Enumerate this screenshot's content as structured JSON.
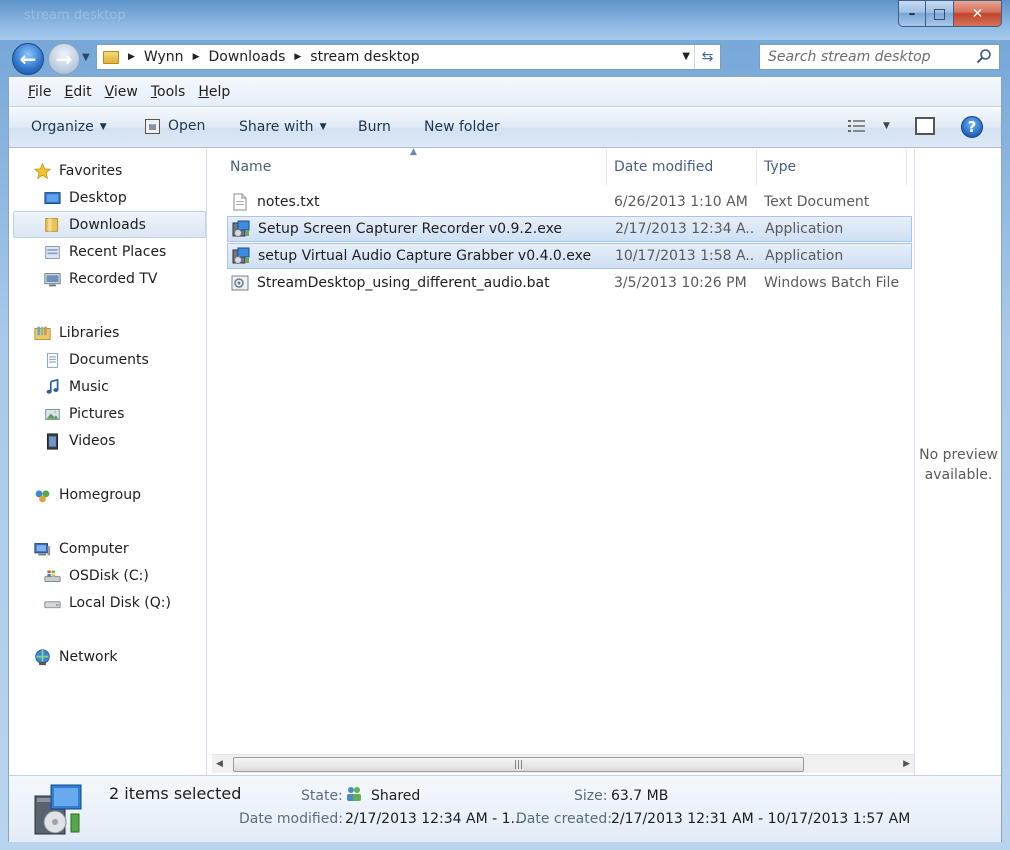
{
  "window": {
    "title": "stream desktop",
    "caption": {
      "minimize": "–",
      "maximize": "□",
      "close": "✕"
    }
  },
  "address": {
    "crumbs": [
      "Wynn",
      "Downloads",
      "stream desktop"
    ],
    "search_placeholder": "Search stream desktop"
  },
  "menu": {
    "items": [
      {
        "label_u": "F",
        "label_rest": "ile"
      },
      {
        "label_u": "E",
        "label_rest": "dit"
      },
      {
        "label_u": "V",
        "label_rest": "iew"
      },
      {
        "label_u": "T",
        "label_rest": "ools"
      },
      {
        "label_u": "H",
        "label_rest": "elp"
      }
    ]
  },
  "toolbar": {
    "organize": "Organize",
    "open": "Open",
    "share_with": "Share with",
    "burn": "Burn",
    "new_folder": "New folder",
    "help": "?"
  },
  "navpane": {
    "favorites": "Favorites",
    "desktop": "Desktop",
    "downloads": "Downloads",
    "recent_places": "Recent Places",
    "recorded_tv": "Recorded TV",
    "libraries": "Libraries",
    "documents": "Documents",
    "music": "Music",
    "pictures": "Pictures",
    "videos": "Videos",
    "homegroup": "Homegroup",
    "computer": "Computer",
    "osdisk": "OSDisk (C:)",
    "local_disk": "Local Disk (Q:)",
    "network": "Network"
  },
  "columns": {
    "name": "Name",
    "date": "Date modified",
    "type": "Type"
  },
  "files": [
    {
      "name": "notes.txt",
      "date": "6/26/2013 1:10 AM",
      "type": "Text Document",
      "selected": false
    },
    {
      "name": "Setup Screen Capturer Recorder v0.9.2.exe",
      "date": "2/17/2013 12:34 A...",
      "type": "Application",
      "selected": true
    },
    {
      "name": "setup Virtual Audio Capture Grabber v0.4.0.exe",
      "date": "10/17/2013 1:58 A...",
      "type": "Application",
      "selected": true
    },
    {
      "name": "StreamDesktop_using_different_audio.bat",
      "date": "3/5/2013 10:26 PM",
      "type": "Windows Batch File",
      "selected": false
    }
  ],
  "preview": {
    "line1": "No preview",
    "line2": "available."
  },
  "details": {
    "count": "2 items selected",
    "state_label": "State:",
    "state_value": "Shared",
    "size_label": "Size:",
    "size_value": "63.7 MB",
    "modified_label": "Date modified:",
    "modified_value": "2/17/2013 12:34 AM - 1...",
    "created_label": "Date created:",
    "created_value": "2/17/2013 12:31 AM - 10/17/2013 1:57 AM"
  },
  "colors": {
    "selection": "#cfe0f4",
    "glass": "#8db7e3",
    "accent": "#1f5fb8"
  }
}
